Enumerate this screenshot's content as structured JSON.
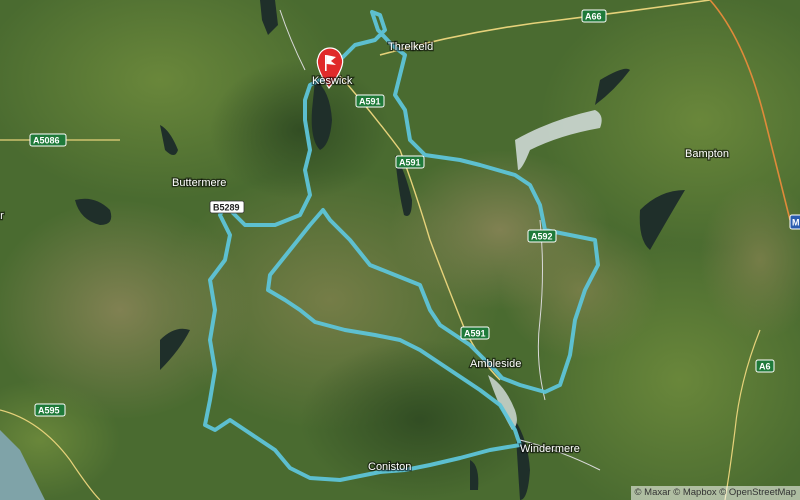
{
  "map": {
    "type": "satellite",
    "attribution": "© Maxar © Mapbox © OpenStreetMap",
    "route_color": "#5ec4d8",
    "start_marker_color": "#e02a2a"
  },
  "places": [
    {
      "id": "keswick",
      "label": "Keswick"
    },
    {
      "id": "threlkeld",
      "label": "Threlkeld"
    },
    {
      "id": "buttermere",
      "label": "Buttermere"
    },
    {
      "id": "bampton",
      "label": "Bampton"
    },
    {
      "id": "ambleside",
      "label": "Ambleside"
    },
    {
      "id": "coniston",
      "label": "Coniston"
    },
    {
      "id": "windermere",
      "label": "Windermere"
    },
    {
      "id": "edge_left",
      "label": "or"
    }
  ],
  "road_shields": [
    {
      "id": "a66",
      "label": "A66",
      "style": "green"
    },
    {
      "id": "a591_1",
      "label": "A591",
      "style": "green"
    },
    {
      "id": "a591_2",
      "label": "A591",
      "style": "green"
    },
    {
      "id": "a591_3",
      "label": "A591",
      "style": "green"
    },
    {
      "id": "a5086",
      "label": "A5086",
      "style": "green"
    },
    {
      "id": "a592",
      "label": "A592",
      "style": "green"
    },
    {
      "id": "a6",
      "label": "A6",
      "style": "green"
    },
    {
      "id": "a595",
      "label": "A595",
      "style": "green"
    },
    {
      "id": "b5289",
      "label": "B5289",
      "style": "white"
    },
    {
      "id": "m_edge",
      "label": "M",
      "style": "blue"
    }
  ]
}
